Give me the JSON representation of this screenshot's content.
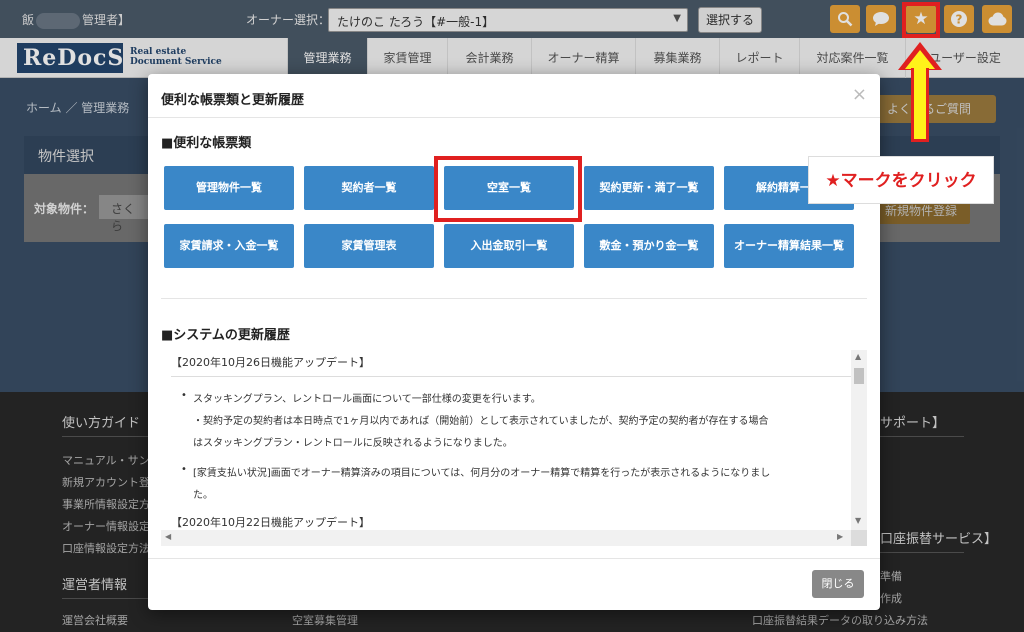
{
  "topbar": {
    "user_prefix": "飯",
    "user_suffix": "管理者】",
    "owner_label": "オーナー選択：",
    "owner_value": "たけのこ たろう【#一般-1】",
    "select_button": "選択する",
    "icons": [
      "search-icon",
      "chat-icon",
      "star-icon",
      "help-icon",
      "cloud-icon"
    ],
    "accent_color": "#e8a23a"
  },
  "navbar": {
    "logo": "ReDocS",
    "logo_sub_1": "Real estate",
    "logo_sub_2": "Document Service",
    "items": [
      "管理業務",
      "家賃管理",
      "会計業務",
      "オーナー精算",
      "募集業務",
      "レポート",
      "対応案件一覧",
      "ユーザー設定"
    ]
  },
  "page": {
    "breadcrumb": "ホーム ／ 管理業務",
    "faq_button": "よくあるご質問",
    "property_section_title": "物件選択",
    "property_label": "対象物件：",
    "property_value": "さくら",
    "new_property_button": "新規物件登録"
  },
  "footer": {
    "guide_title": "使い方ガイド",
    "guide_links": [
      "マニュアル・サンプル",
      "新規アカウント登録",
      "事業所情報設定方法",
      "オーナー情報設定",
      "口座情報設定方法"
    ],
    "operator_title": "運営者情報",
    "operator_links": [
      "運営会社概要"
    ],
    "middle_link": "空室募集管理",
    "support_title": "サポート】",
    "transfer_title": "口座振替サービス】",
    "transfer_links": [
      "準備",
      "作成",
      "口座振替結果データの取り込み方法"
    ]
  },
  "modal": {
    "title": "便利な帳票類と更新履歴",
    "close_symbol": "×",
    "docs_title": "■便利な帳票類",
    "doc_buttons_row1": [
      "管理物件一覧",
      "契約者一覧",
      "空室一覧",
      "契約更新・満了一覧",
      "解約精算一覧"
    ],
    "doc_buttons_row2": [
      "家賃請求・入金一覧",
      "家賃管理表",
      "入出金取引一覧",
      "敷金・預かり金一覧",
      "オーナー精算結果一覧"
    ],
    "history_title": "■システムの更新履歴",
    "history": [
      {
        "date": "【2020年10月26日機能アップデート】",
        "lines": [
          "スタッキングプラン、レントロール画面について一部仕様の変更を行います。",
          "・契約予定の契約者は本日時点で1ヶ月以内であれば（開始前）として表示されていましたが、契約予定の契約者が存在する場合",
          "はスタッキングプラン・レントロールに反映されるようになりました。",
          "[家賃支払い状況]画面でオーナー精算済みの項目については、何月分のオーナー精算で精算を行ったが表示されるようになりまし",
          "た。"
        ]
      },
      {
        "date": "【2020年10月22日機能アップデート】",
        "lines": []
      }
    ],
    "close_button": "閉じる"
  },
  "annotation": {
    "callout_text": "★マークをクリック",
    "highlight_color": "#e02020"
  }
}
